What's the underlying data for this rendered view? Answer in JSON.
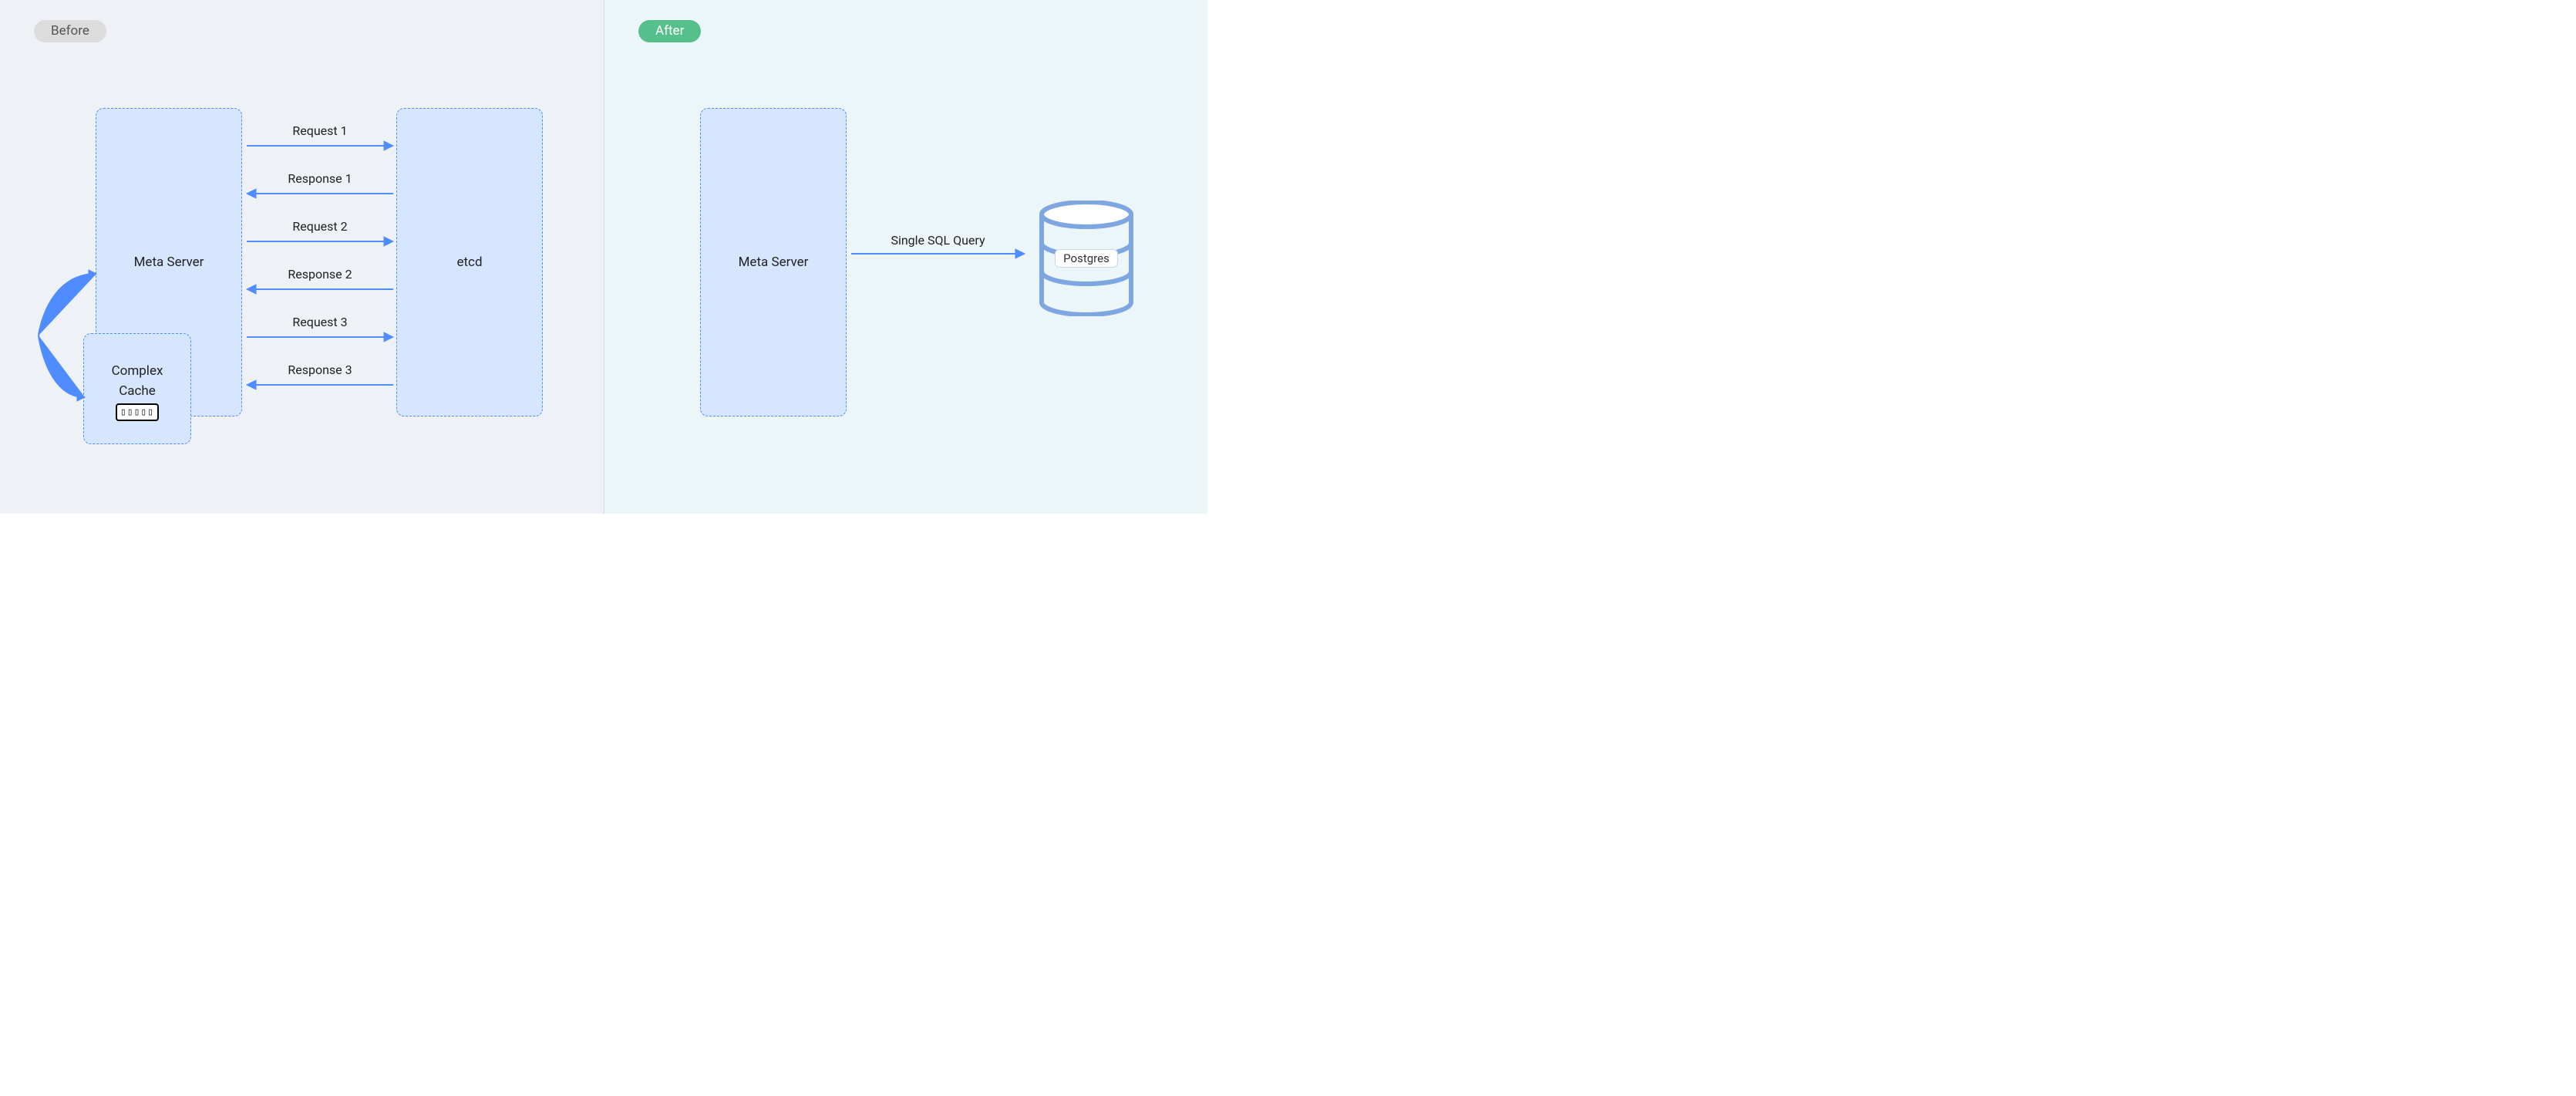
{
  "before": {
    "badge": "Before",
    "meta_server": "Meta Server",
    "etcd": "etcd",
    "cache": {
      "line1": "Complex",
      "line2": "Cache"
    },
    "messages": [
      {
        "label": "Request 1",
        "dir": "right"
      },
      {
        "label": "Response 1",
        "dir": "left"
      },
      {
        "label": "Request 2",
        "dir": "right"
      },
      {
        "label": "Response 2",
        "dir": "left"
      },
      {
        "label": "Request 3",
        "dir": "right"
      },
      {
        "label": "Response 3",
        "dir": "left"
      }
    ]
  },
  "after": {
    "badge": "After",
    "meta_server": "Meta Server",
    "sql_label": "Single SQL Query",
    "db_label": "Postgres"
  },
  "colors": {
    "node_border": "#4f8cff",
    "node_fill": "#d7e6ff",
    "arrow": "#4f8cff",
    "badge_before_bg": "#dcdcdc",
    "badge_after_bg": "#56c08d",
    "panel_left_bg": "#eef2f6",
    "panel_right_bg": "#ecf6f8"
  }
}
